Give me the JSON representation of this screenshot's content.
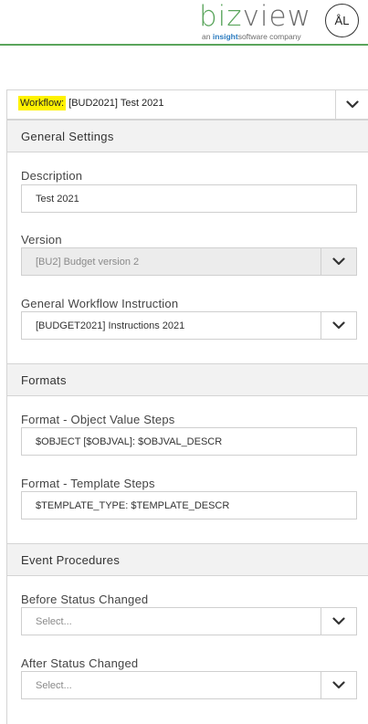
{
  "header": {
    "logo_biz": "biz",
    "logo_view": "view",
    "tagline_prefix": "an ",
    "tagline_brand": "insight",
    "tagline_suffix": "software company",
    "avatar_initials": "ÅL"
  },
  "workflow_bar": {
    "label": "Workflow:",
    "value": "[BUD2021] Test 2021"
  },
  "sections": {
    "general": {
      "title": "General Settings",
      "description": {
        "label": "Description",
        "value": "Test 2021"
      },
      "version": {
        "label": "Version",
        "value": "[BU2] Budget version 2"
      },
      "instruction": {
        "label": "General Workflow Instruction",
        "value": "[BUDGET2021] Instructions 2021"
      }
    },
    "formats": {
      "title": "Formats",
      "object_value": {
        "label": "Format - Object Value Steps",
        "value": "$OBJECT [$OBJVAL]: $OBJVAL_DESCR"
      },
      "template": {
        "label": "Format - Template Steps",
        "value": "$TEMPLATE_TYPE: $TEMPLATE_DESCR"
      }
    },
    "events": {
      "title": "Event Procedures",
      "before": {
        "label": "Before Status Changed",
        "placeholder": "Select..."
      },
      "after": {
        "label": "After Status Changed",
        "placeholder": "Select..."
      }
    }
  },
  "colors": {
    "brand_green": "#5aa55c",
    "highlight": "#fff200"
  }
}
